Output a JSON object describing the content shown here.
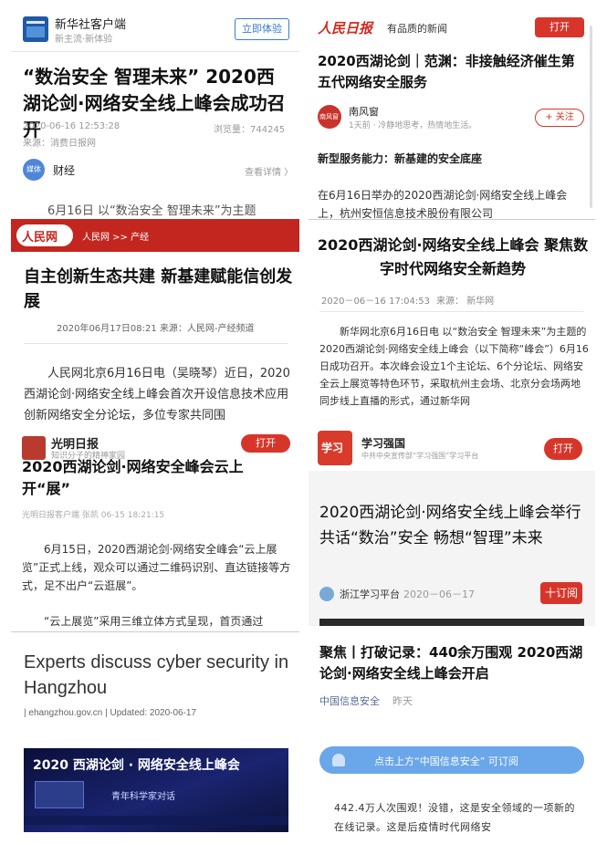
{
  "p1": {
    "app_name": "新华社客户端",
    "app_slogan": "新主流·新体验",
    "open_button": "立即体验",
    "headline": "“数治安全 智理未来” 2020西湖论剑·网络安全线上峰会成功召开",
    "date": "2020-06-16 12:53:28",
    "views": "浏览量：744245",
    "source": "来源：消费日报网",
    "channel_badge": "媒体",
    "channel": "财经",
    "view_detail": "查看详情 〉",
    "body_peek": "6月16日 以“数治安全 智理未来”为主题"
  },
  "p2": {
    "brand": "人民网",
    "breadcrumb": "人民网 >> 产经",
    "headline": "自主创新生态共建 新基建赋能信创发展",
    "meta": "2020年06月17日08:21  来源：人民网-产经频道",
    "body": "人民网北京6月16日电（吴晓琴）近日，2020西湖论剑·网络安全线上峰会首次开设信息技术应用创新网络安全分论坛，多位专家共同围"
  },
  "p3": {
    "brand": "光明日报",
    "subline": "知识分子的精神家园",
    "open_button": "打开",
    "headline": "2020西湖论剑·网络安全峰会云上开“展”",
    "meta": "光明日报客户端 张凯  06-15 18:21:15",
    "para1": "6月15日，2020西湖论剑·网络安全峰会“云上展览”正式上线，观众可以通过二维码识别、直达链接等方式，足不出户“云逛展”。",
    "para2": "“云上展览”采用三维立体方式呈现，首页通过"
  },
  "p4": {
    "headline": "Experts discuss cyber security in Hangzhou",
    "meta": "| ehangzhou.gov.cn | Updated: 2020-06-17",
    "banner_title": "2020 西湖论剑 · 网络安全线上峰会",
    "banner_sub": "青年科学家对话"
  },
  "p5": {
    "brand": "人民日报",
    "tagline": "有品质的新闻",
    "open_button": "打开",
    "headline": "2020西湖论剑｜范渊：非接触经济催生第五代网络安全服务",
    "author": "南风窗",
    "author_logo": "南风窗",
    "author_meta": "1天前 · 冷静地思考，热情地生活。",
    "follow_button": "+ 关注",
    "subhead": "新型服务能力：新基建的安全底座",
    "body": "在6月16日举办的2020西湖论剑·网络安全线上峰会上，杭州安恒信息技术股份有限公司"
  },
  "p6": {
    "headline": "2020西湖论剑·网络安全线上峰会 聚焦数字时代网络安全新趋势",
    "date": "2020－06－16 17:04:53",
    "source": "来源：  新华网",
    "body": "新华网北京6月16日电 以“数治安全 智理未来”为主题的2020西湖论剑·网络安全线上峰会（以下简称“峰会”）6月16日成功召开。本次峰会设立1个主论坛、6个分论坛、网络安全云上展览等特色环节，采取杭州主会场、北京分会场两地同步线上直播的形式，通过新华网"
  },
  "p7": {
    "app_logo": "学习",
    "app_name": "学习强国",
    "app_sub": "中共中央宣传部“学习强国”学习平台",
    "open_button": "打开",
    "headline": "2020西湖论剑·网络安全线上峰会举行 共话“数治”安全 畅想“智理”未来",
    "channel": "浙江学习平台",
    "date": "2020－06－17",
    "subscribe": "十订阅"
  },
  "p8": {
    "headline": "聚焦丨打破记录：440余万围观 2020西湖论剑·网络安全线上峰会开启",
    "account": "中国信息安全",
    "time": "昨天",
    "subscribe_tip": "点击上方“中国信息安全” 可订阅",
    "body": "442.4万人次围观！没错，这是安全领域的一项新的在线记录。这是后疫情时代网络安"
  }
}
